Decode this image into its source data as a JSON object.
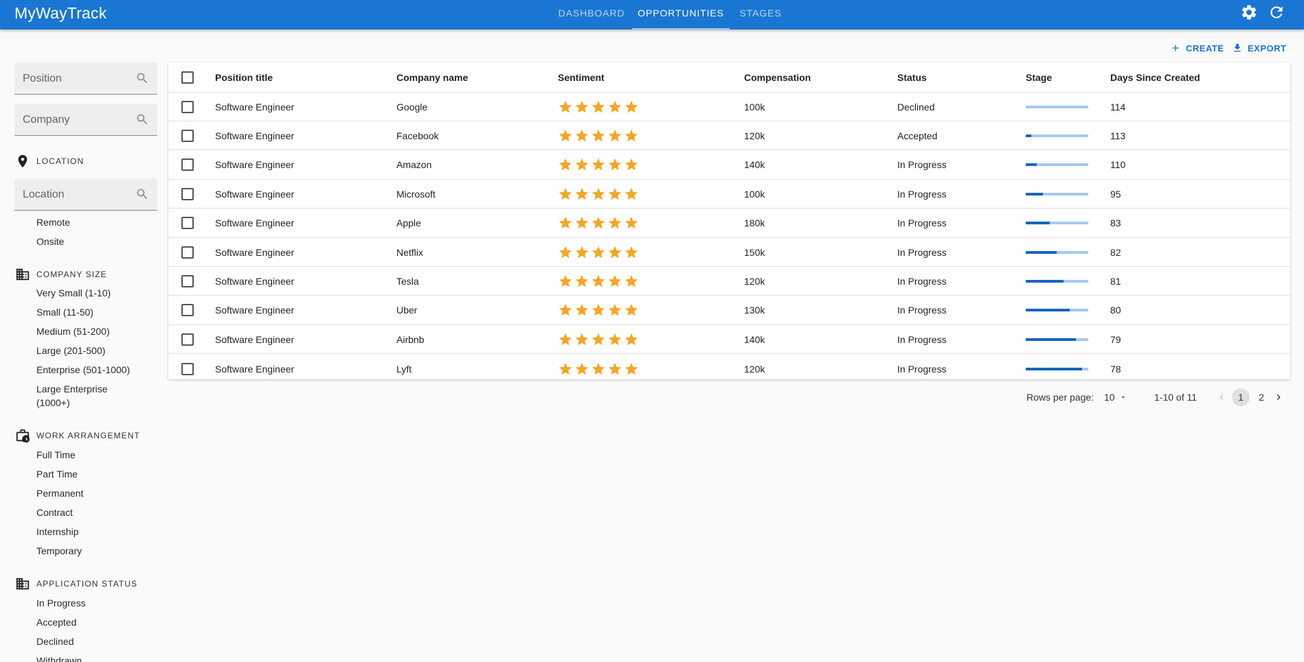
{
  "app": {
    "title": "MyWayTrack",
    "tabs": [
      {
        "label": "DASHBOARD",
        "active": false
      },
      {
        "label": "OPPORTUNITIES",
        "active": true
      },
      {
        "label": "STAGES",
        "active": false
      }
    ],
    "settings_icon": "gear-icon",
    "refresh_icon": "refresh-icon",
    "accent": "#1976d2"
  },
  "toolbar": {
    "create_label": "CREATE",
    "export_label": "EXPORT"
  },
  "sidebar": {
    "position_search": {
      "placeholder": "Position"
    },
    "company_search": {
      "placeholder": "Company"
    },
    "location": {
      "title": "LOCATION",
      "icon": "location-pin-icon",
      "search_placeholder": "Location",
      "items": [
        "Remote",
        "Onsite"
      ]
    },
    "company_size": {
      "title": "COMPANY SIZE",
      "icon": "building-icon",
      "items": [
        "Very Small (1-10)",
        "Small (11-50)",
        "Medium (51-200)",
        "Large (201-500)",
        "Enterprise (501-1000)",
        "Large Enterprise (1000+)"
      ]
    },
    "work_arrangement": {
      "title": "WORK ARRANGEMENT",
      "icon": "work-history-icon",
      "items": [
        "Full Time",
        "Part Time",
        "Permanent",
        "Contract",
        "Internship",
        "Temporary"
      ]
    },
    "application_status": {
      "title": "APPLICATION STATUS",
      "icon": "building-icon",
      "items": [
        "In Progress",
        "Accepted",
        "Declined",
        "Withdrawn"
      ]
    }
  },
  "table": {
    "columns": [
      "Position title",
      "Company name",
      "Sentiment",
      "Compensation",
      "Status",
      "Stage",
      "Days Since Created"
    ],
    "star_color": "#f5a623",
    "rows": [
      {
        "position": "Software Engineer",
        "company": "Google",
        "sentiment": 5,
        "compensation": "100k",
        "status": "Declined",
        "stage_progress": 0.0,
        "days": "114"
      },
      {
        "position": "Software Engineer",
        "company": "Facebook",
        "sentiment": 5,
        "compensation": "120k",
        "status": "Accepted",
        "stage_progress": 0.09,
        "days": "113"
      },
      {
        "position": "Software Engineer",
        "company": "Amazon",
        "sentiment": 5,
        "compensation": "140k",
        "status": "In Progress",
        "stage_progress": 0.18,
        "days": "110"
      },
      {
        "position": "Software Engineer",
        "company": "Microsoft",
        "sentiment": 5,
        "compensation": "100k",
        "status": "In Progress",
        "stage_progress": 0.28,
        "days": "95"
      },
      {
        "position": "Software Engineer",
        "company": "Apple",
        "sentiment": 5,
        "compensation": "180k",
        "status": "In Progress",
        "stage_progress": 0.38,
        "days": "83"
      },
      {
        "position": "Software Engineer",
        "company": "Netflix",
        "sentiment": 5,
        "compensation": "150k",
        "status": "In Progress",
        "stage_progress": 0.49,
        "days": "82"
      },
      {
        "position": "Software Engineer",
        "company": "Tesla",
        "sentiment": 5,
        "compensation": "120k",
        "status": "In Progress",
        "stage_progress": 0.6,
        "days": "81"
      },
      {
        "position": "Software Engineer",
        "company": "Uber",
        "sentiment": 5,
        "compensation": "130k",
        "status": "In Progress",
        "stage_progress": 0.7,
        "days": "80"
      },
      {
        "position": "Software Engineer",
        "company": "Airbnb",
        "sentiment": 5,
        "compensation": "140k",
        "status": "In Progress",
        "stage_progress": 0.8,
        "days": "79"
      },
      {
        "position": "Software Engineer",
        "company": "Lyft",
        "sentiment": 5,
        "compensation": "120k",
        "status": "In Progress",
        "stage_progress": 0.9,
        "days": "78"
      }
    ]
  },
  "pagination": {
    "rows_per_page_label": "Rows per page:",
    "rows_per_page": "10",
    "range": "1-10 of 11",
    "pages": [
      "1",
      "2"
    ],
    "current_page": "1"
  }
}
